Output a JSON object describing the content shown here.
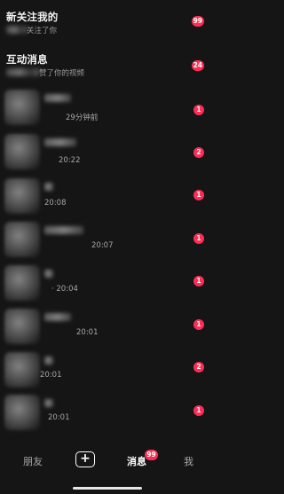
{
  "sections": {
    "new_followers": {
      "title": "新关注我的",
      "subtitle": "关注了你",
      "badge": "99"
    },
    "interactions": {
      "title": "互动消息",
      "subtitle": "赞了你的视频",
      "badge": "24"
    }
  },
  "conversations": [
    {
      "time": "29分钟前",
      "badge": "1"
    },
    {
      "time": "20:22",
      "badge": "2"
    },
    {
      "time": "20:08",
      "badge": "1"
    },
    {
      "time": "20:07",
      "badge": "1"
    },
    {
      "time": "· 20:04",
      "badge": "1"
    },
    {
      "time": "20:01",
      "badge": "1"
    },
    {
      "time": "20:01",
      "badge": "2"
    },
    {
      "time": "20:01",
      "badge": "1"
    }
  ],
  "tabbar": {
    "friends": "朋友",
    "plus": "+",
    "messages": "消息",
    "messages_badge": "99",
    "me": "我"
  }
}
